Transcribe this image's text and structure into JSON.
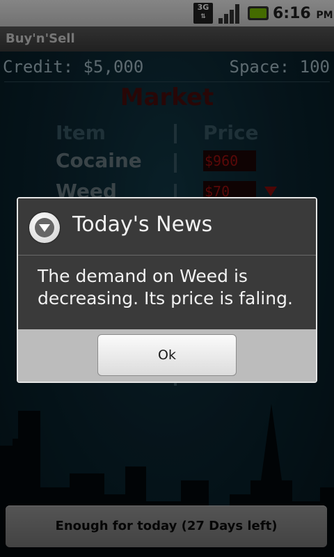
{
  "status_bar": {
    "network": "3G",
    "time": "6:16",
    "ampm": "PM",
    "colors": {
      "battery": "#7cc400"
    }
  },
  "app": {
    "title": "Buy'n'Sell"
  },
  "info": {
    "credit": "Credit: $5,000",
    "space": "Space: 100"
  },
  "market": {
    "title": "Market",
    "col_item": "Item",
    "col_price": "Price",
    "rows": [
      {
        "item": "Cocaine",
        "price": "$960"
      },
      {
        "item": "Weed",
        "price": "$70",
        "trend": "down"
      }
    ]
  },
  "dialog": {
    "title": "Today's News",
    "message": "The demand on Weed is decreasing. Its price is faling.",
    "ok_label": "Ok",
    "icon": "chevron-down-circle-icon"
  },
  "bottom": {
    "button_label": "Enough for today (27 Days left)"
  }
}
